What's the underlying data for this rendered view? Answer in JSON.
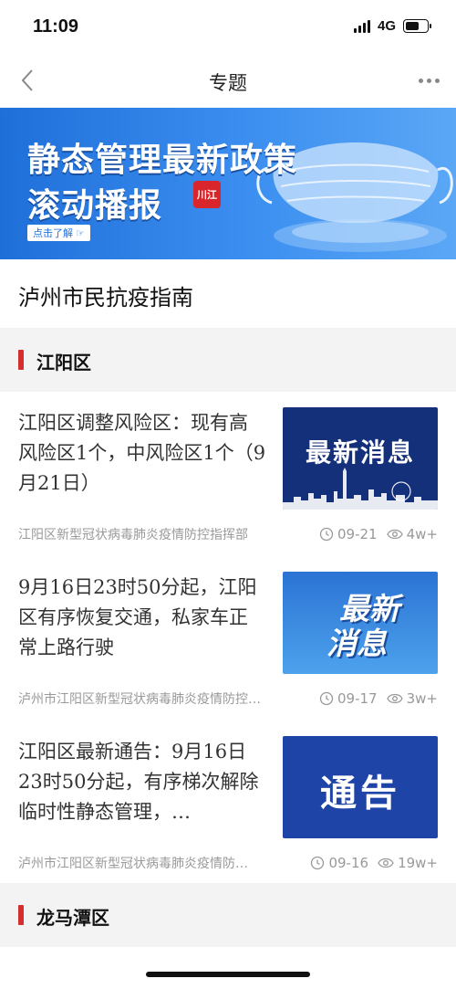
{
  "status_bar": {
    "time": "11:09",
    "network": "4G",
    "battery_level": 0.8
  },
  "nav": {
    "title": "专题"
  },
  "banner": {
    "line1": "静态管理最新政策",
    "line2": "滚动播报",
    "badge": "川江",
    "cta": "点击了解"
  },
  "page_heading": "泸州市民抗疫指南",
  "sections": [
    {
      "label": "江阳区"
    },
    {
      "label": "龙马潭区"
    }
  ],
  "articles": [
    {
      "title": "江阳区调整风险区：现有高风险区1个，中风险区1个（9月21日）",
      "thumb_text": "最新消息",
      "source": "江阳区新型冠状病毒肺炎疫情防控指挥部",
      "date": "09-21",
      "views": "4w+"
    },
    {
      "title": "9月16日23时50分起，江阳区有序恢复交通，私家车正常上路行驶",
      "thumb_text_1": "最新",
      "thumb_text_2": "消息",
      "source": "泸州市江阳区新型冠状病毒肺炎疫情防控…",
      "date": "09-17",
      "views": "3w+"
    },
    {
      "title": "江阳区最新通告：9月16日23时50分起，有序梯次解除临时性静态管理，…",
      "thumb_text": "通告",
      "source": "泸州市江阳区新型冠状病毒肺炎疫情防…",
      "date": "09-16",
      "views": "19w+"
    }
  ],
  "colors": {
    "accent_red": "#d32f2f",
    "banner_blue": "#1f6fd9"
  }
}
